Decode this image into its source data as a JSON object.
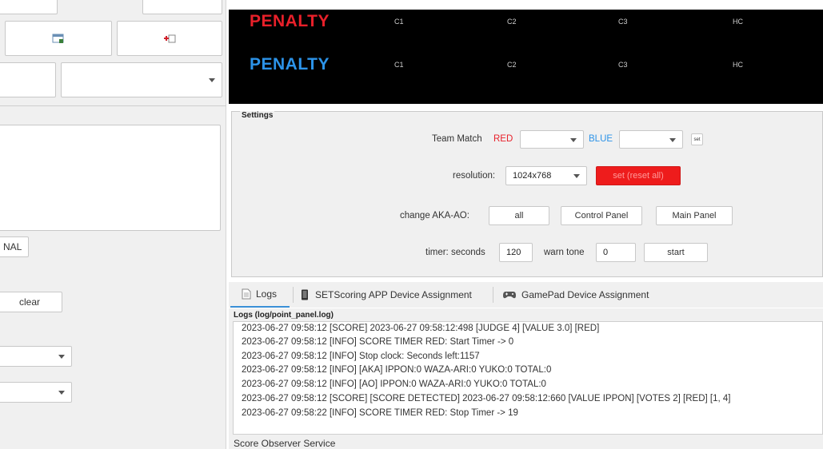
{
  "left": {
    "clear_label": "clear",
    "final_label": "NAL"
  },
  "scoreboard": {
    "rows": [
      {
        "label": "PENALTY",
        "color": "#e8202a",
        "cols": [
          "C1",
          "C2",
          "C3",
          "HC"
        ]
      },
      {
        "label": "PENALTY",
        "color": "#2c93e8",
        "cols": [
          "C1",
          "C2",
          "C3",
          "HC"
        ]
      }
    ]
  },
  "settings": {
    "title": "Settings",
    "team_match_label": "Team Match",
    "red_label": "RED",
    "blue_label": "BLUE",
    "set_small_label": "set",
    "resolution_label": "resolution:",
    "resolution_value": "1024x768",
    "set_reset_label": "set (reset all)",
    "change_label": "change  AKA-AO:",
    "all_label": "all",
    "control_panel_label": "Control Panel",
    "main_panel_label": "Main Panel",
    "timer_label": "timer: seconds",
    "timer_value": "120",
    "warn_tone_label": "warn tone",
    "warn_tone_value": "0",
    "start_label": "start"
  },
  "tabs": [
    {
      "label": "Logs",
      "icon": "document-icon"
    },
    {
      "label": "SETScoring APP Device Assignment",
      "icon": "phone-icon"
    },
    {
      "label": "GamePad Device Assignment",
      "icon": "gamepad-icon"
    }
  ],
  "logs": {
    "title": "Logs (log/point_panel.log)",
    "lines": [
      "2023-06-27 09:58:12 [SCORE] 2023-06-27 09:58:12:498 [JUDGE 4] [VALUE 3.0] [RED]",
      "2023-06-27 09:58:12 [INFO] SCORE TIMER RED: Start Timer -> 0",
      "2023-06-27 09:58:12 [INFO] Stop clock: Seconds left:1157",
      "2023-06-27 09:58:12 [INFO]  [AKA]  IPPON:0 WAZA-ARI:0 YUKO:0 TOTAL:0",
      "2023-06-27 09:58:12 [INFO]  [AO]   IPPON:0 WAZA-ARI:0 YUKO:0 TOTAL:0",
      "2023-06-27 09:58:12 [SCORE] [SCORE DETECTED] 2023-06-27 09:58:12:660 [VALUE IPPON] [VOTES 2] [RED] [1, 4]",
      "2023-06-27 09:58:22 [INFO] SCORE TIMER RED: Stop Timer -> 19"
    ]
  },
  "status": {
    "text": "Score Observer Service"
  }
}
